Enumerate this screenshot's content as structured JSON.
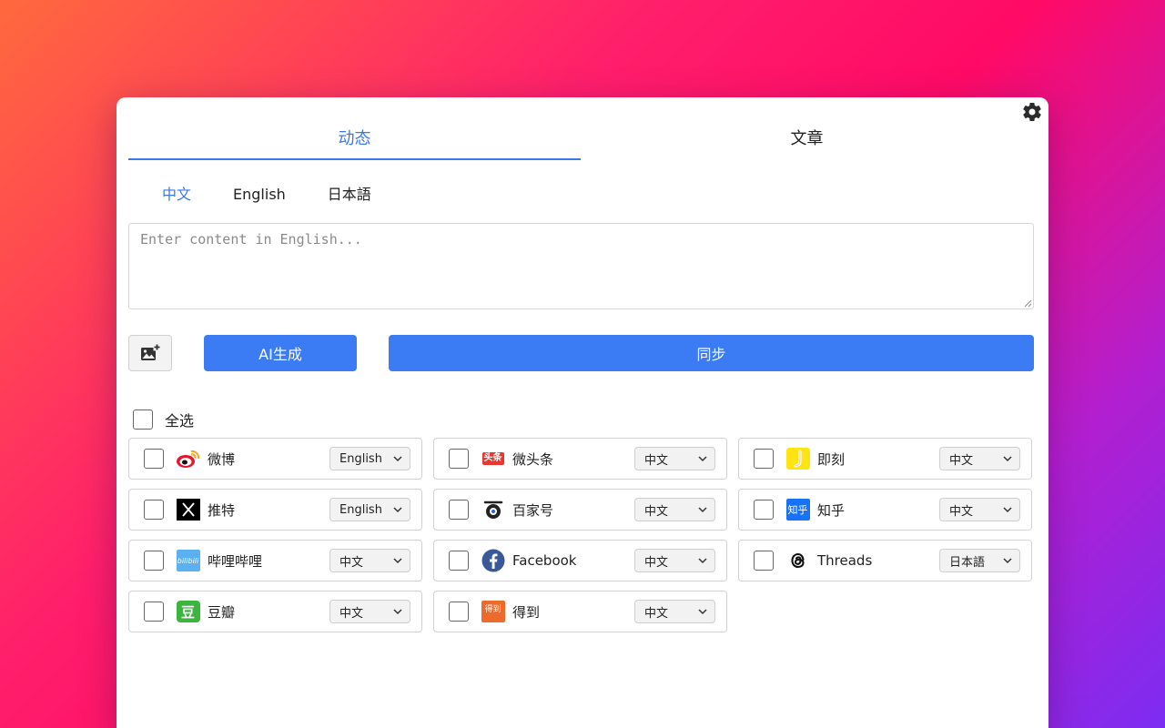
{
  "tabs": [
    {
      "label": "动态",
      "active": true
    },
    {
      "label": "文章",
      "active": false
    }
  ],
  "languages": [
    "中文",
    "English",
    "日本語"
  ],
  "active_language": "中文",
  "content_input": {
    "placeholder": "Enter content in English...",
    "value": ""
  },
  "actions": {
    "image_icon": "image-add-icon",
    "ai_label": "AI生成",
    "sync_label": "同步"
  },
  "select_all": {
    "label": "全选",
    "checked": false
  },
  "platforms": [
    {
      "name": "微博",
      "icon": "weibo-icon",
      "lang": "English",
      "checked": false
    },
    {
      "name": "微头条",
      "icon": "toutiao-icon",
      "lang": "中文",
      "checked": false
    },
    {
      "name": "即刻",
      "icon": "jike-icon",
      "lang": "中文",
      "checked": false
    },
    {
      "name": "推特",
      "icon": "x-icon",
      "lang": "English",
      "checked": false
    },
    {
      "name": "百家号",
      "icon": "baijiahao-icon",
      "lang": "中文",
      "checked": false
    },
    {
      "name": "知乎",
      "icon": "zhihu-icon",
      "lang": "中文",
      "checked": false
    },
    {
      "name": "哔哩哔哩",
      "icon": "bilibili-icon",
      "lang": "中文",
      "checked": false
    },
    {
      "name": "Facebook",
      "icon": "facebook-icon",
      "lang": "中文",
      "checked": false
    },
    {
      "name": "Threads",
      "icon": "threads-icon",
      "lang": "日本語",
      "checked": false
    },
    {
      "name": "豆瓣",
      "icon": "douban-icon",
      "lang": "中文",
      "checked": false
    },
    {
      "name": "得到",
      "icon": "dedao-icon",
      "lang": "中文",
      "checked": false
    }
  ],
  "logo_texts": {
    "toutiao": "头条",
    "zhihu": "知乎",
    "bilibili": "bilibili",
    "douban": "豆",
    "dedao": "得到"
  },
  "colors": {
    "accent": "#3b7cf4",
    "tab_active": "#3b78e7"
  }
}
